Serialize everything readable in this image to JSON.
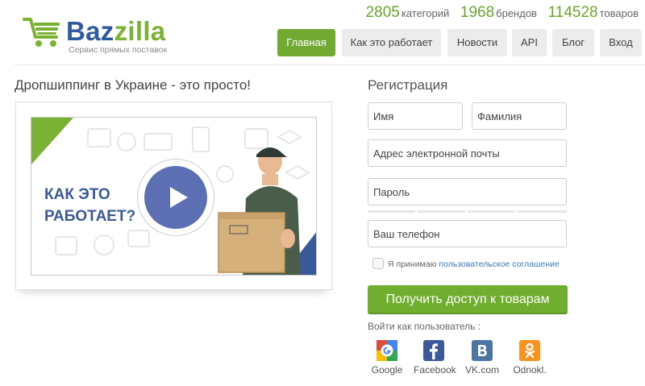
{
  "brand": {
    "name_part1": "Baz",
    "name_part2": "zilla",
    "tagline": "Сервис прямых поставок",
    "colors": {
      "blue": "#2f5aa3",
      "green": "#7ab234"
    }
  },
  "stats": [
    {
      "value": "2805",
      "label": "категорий"
    },
    {
      "value": "1968",
      "label": "брендов"
    },
    {
      "value": "114528",
      "label": "товаров"
    }
  ],
  "nav": {
    "items": [
      {
        "label": "Главная",
        "active": true
      },
      {
        "label": "Как это работает",
        "active": false
      },
      {
        "label": "Новости",
        "active": false
      },
      {
        "label": "API",
        "active": false
      },
      {
        "label": "Блог",
        "active": false
      },
      {
        "label": "Вход",
        "active": false
      }
    ]
  },
  "main": {
    "title": "Дропшиппинг в Украине - это просто!",
    "video": {
      "line1": "КАК ЭТО",
      "line2": "РАБОТАЕТ?",
      "play_icon": "play-icon"
    }
  },
  "registration": {
    "title": "Регистрация",
    "first_name_placeholder": "Имя",
    "last_name_placeholder": "Фамилия",
    "email_placeholder": "Адрес электронной почты",
    "password_placeholder": "Пароль",
    "phone_placeholder": "Ваш телефон",
    "agree_text": "Я принимаю ",
    "agree_link": "пользовательское соглашение",
    "submit_label": "Получить доступ к товарам",
    "accent": "#6fae2e"
  },
  "social": {
    "title": "Войти как пользователь :",
    "items": [
      {
        "label": "Google",
        "icon": "google-icon",
        "color": "#dd4b39"
      },
      {
        "label": "Facebook",
        "icon": "facebook-icon",
        "color": "#3b5998"
      },
      {
        "label": "VK.com",
        "icon": "vk-icon",
        "color": "#4c75a3"
      },
      {
        "label": "Odnokl.",
        "icon": "odnoklassniki-icon",
        "color": "#f7931e"
      }
    ]
  }
}
